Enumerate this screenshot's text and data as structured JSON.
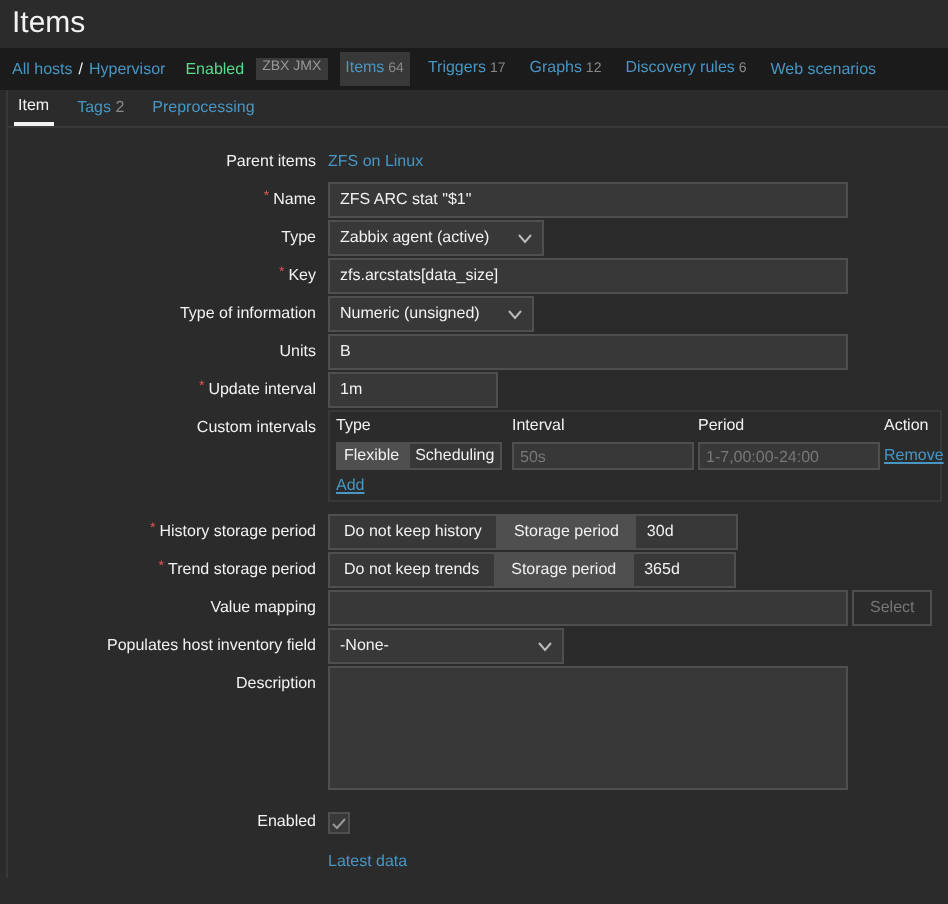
{
  "page_title": "Items",
  "breadcrumbs": [
    {
      "label": "All hosts"
    },
    {
      "label": "Hypervisor"
    }
  ],
  "breadcrumb_separator": "/",
  "host_status": "Enabled",
  "required_marker": "*",
  "jmx_badge": "ZBX JMX",
  "nav_tabs": [
    {
      "label": "Items",
      "count": "64",
      "selected": true
    },
    {
      "label": "Triggers",
      "count": "17",
      "selected": false
    },
    {
      "label": "Graphs",
      "count": "12",
      "selected": false
    },
    {
      "label": "Discovery rules",
      "count": "6",
      "selected": false
    },
    {
      "label": "Web scenarios",
      "selected": false
    }
  ],
  "form_tabs": [
    {
      "label": "Item",
      "selected": true
    },
    {
      "label": "Tags",
      "count": "2",
      "selected": false
    },
    {
      "label": "Preprocessing",
      "selected": false
    }
  ],
  "fields": [
    {
      "kind": "link",
      "label": "Parent items",
      "required": false,
      "value": "ZFS on Linux"
    },
    {
      "kind": "text",
      "label": "Name",
      "required": true,
      "value": "ZFS ARC stat \"$1\""
    },
    {
      "kind": "select",
      "label": "Type",
      "required": false,
      "value": "Zabbix agent (active)"
    },
    {
      "kind": "text",
      "label": "Key",
      "required": true,
      "value": "zfs.arcstats[data_size]"
    },
    {
      "kind": "select",
      "label": "Type of information",
      "required": false,
      "value": "Numeric (unsigned)"
    },
    {
      "kind": "text",
      "label": "Units",
      "required": false,
      "value": "B"
    },
    {
      "kind": "short-text",
      "label": "Update interval",
      "required": true,
      "value": "1m"
    },
    {
      "kind": "intervals",
      "label": "Custom intervals",
      "required": false,
      "columns": [
        "Type",
        "Interval",
        "Period",
        "Action"
      ],
      "rows": [
        {
          "modes": [
            {
              "label": "Flexible",
              "selected": true
            },
            {
              "label": "Scheduling",
              "selected": false
            }
          ],
          "interval_placeholder": "50s",
          "period_placeholder": "1-7,00:00-24:00",
          "action": "Remove"
        }
      ],
      "add": "Add"
    },
    {
      "kind": "storage",
      "label": "History storage period",
      "required": true,
      "options": [
        {
          "label": "Do not keep history",
          "selected": false
        },
        {
          "label": "Storage period",
          "selected": true
        }
      ],
      "value": "30d"
    },
    {
      "kind": "storage",
      "label": "Trend storage period",
      "required": true,
      "options": [
        {
          "label": "Do not keep trends",
          "selected": false
        },
        {
          "label": "Storage period",
          "selected": true
        }
      ],
      "value": "365d"
    },
    {
      "kind": "valuemap",
      "label": "Value mapping",
      "required": false,
      "button": "Select",
      "button_disabled": true
    },
    {
      "kind": "wide-select",
      "label": "Populates host inventory field",
      "required": false,
      "value": "-None-"
    },
    {
      "kind": "textarea",
      "label": "Description",
      "required": false
    },
    {
      "kind": "checkbox",
      "label": "Enabled",
      "required": false,
      "checked": true
    },
    {
      "kind": "footer-link",
      "value": "Latest data"
    }
  ]
}
